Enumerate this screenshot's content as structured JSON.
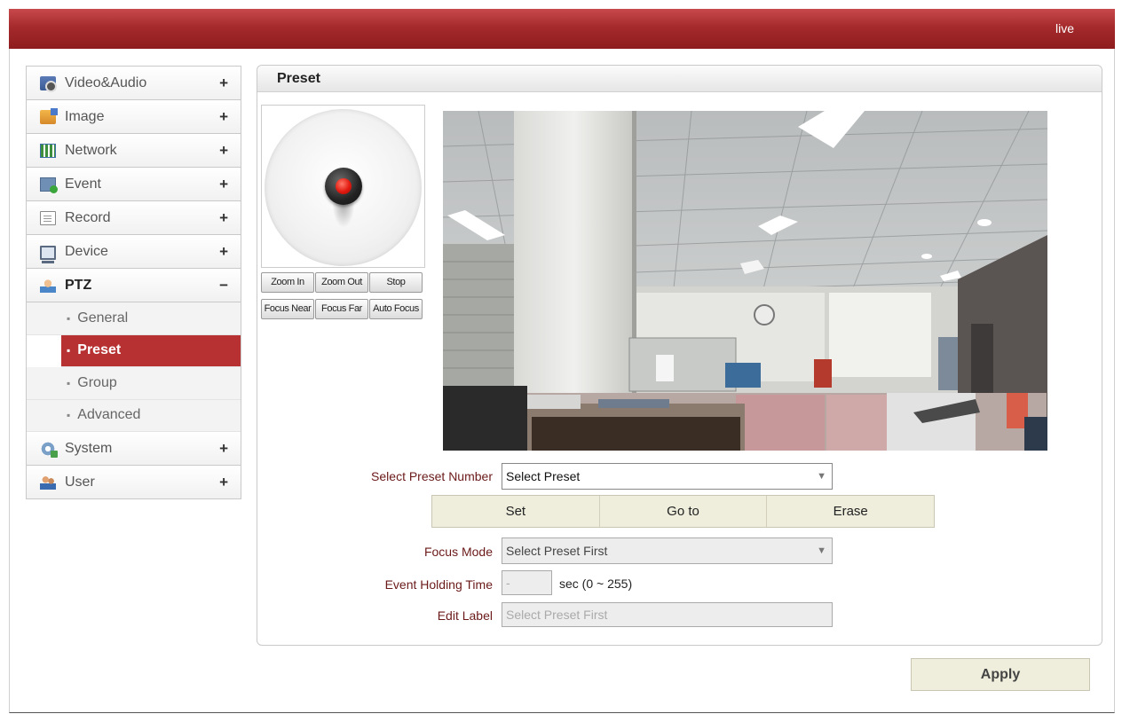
{
  "header": {
    "live_link": "live"
  },
  "sidebar": {
    "items": [
      {
        "label": "Video&Audio",
        "sign": "+"
      },
      {
        "label": "Image",
        "sign": "+"
      },
      {
        "label": "Network",
        "sign": "+"
      },
      {
        "label": "Event",
        "sign": "+"
      },
      {
        "label": "Record",
        "sign": "+"
      },
      {
        "label": "Device",
        "sign": "+"
      },
      {
        "label": "PTZ",
        "sign": "−"
      },
      {
        "label": "System",
        "sign": "+"
      },
      {
        "label": "User",
        "sign": "+"
      }
    ],
    "ptz_subitems": [
      {
        "label": "General"
      },
      {
        "label": "Preset"
      },
      {
        "label": "Group"
      },
      {
        "label": "Advanced"
      }
    ],
    "bullet": "▪",
    "active_subitem": "Preset"
  },
  "panel": {
    "title": "Preset"
  },
  "ptz_controls": {
    "zoom_in": "Zoom In",
    "zoom_out": "Zoom Out",
    "stop": "Stop",
    "focus_near": "Focus Near",
    "focus_far": "Focus Far",
    "auto_focus": "Auto Focus"
  },
  "form": {
    "preset_number_label": "Select Preset Number",
    "preset_number_value": "Select Preset",
    "set_button": "Set",
    "goto_button": "Go to",
    "erase_button": "Erase",
    "focus_mode_label": "Focus Mode",
    "focus_mode_value": "Select Preset First",
    "event_holding_label": "Event Holding Time",
    "event_holding_value": "-",
    "event_holding_unit": "sec (0 ~ 255)",
    "edit_label_label": "Edit Label",
    "edit_label_placeholder": "Select Preset First",
    "dropdown_arrow": "▼"
  },
  "apply_button": "Apply"
}
